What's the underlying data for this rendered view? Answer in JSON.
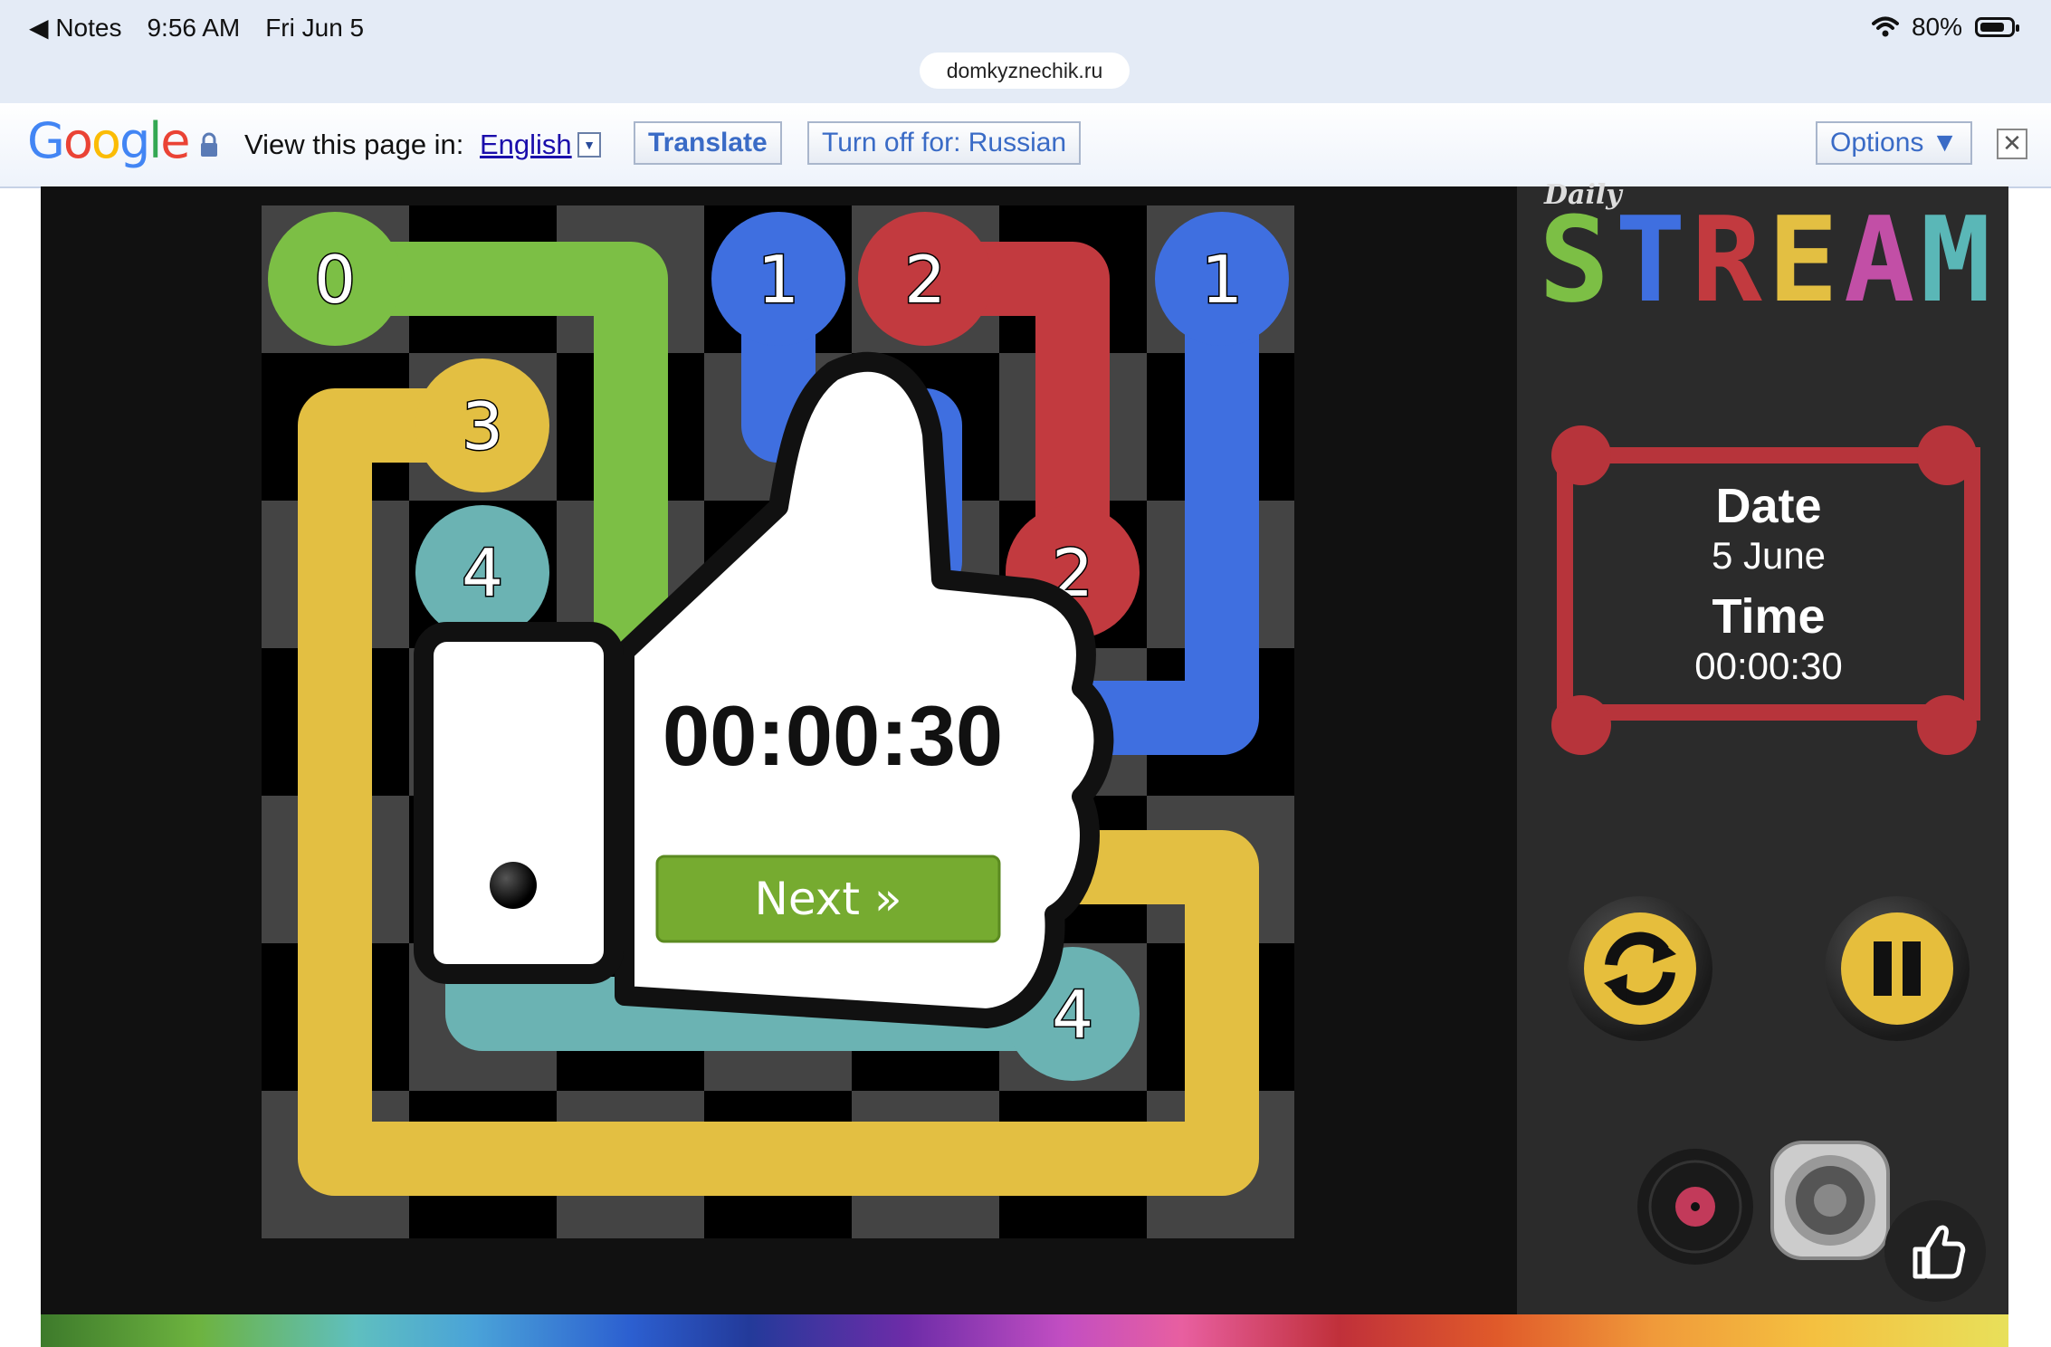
{
  "status_bar": {
    "back_label": "◀ Notes",
    "time": "9:56 AM",
    "date": "Fri Jun 5",
    "battery": "80%",
    "url": "domkyznechik.ru"
  },
  "translate_bar": {
    "prompt": "View this page in:",
    "language": "English",
    "translate_label": "Translate",
    "turn_off_label": "Turn off for: Russian",
    "options_label": "Options ▼",
    "close_symbol": "✕",
    "google_letters": [
      "G",
      "o",
      "o",
      "g",
      "l",
      "e"
    ]
  },
  "game": {
    "title_small": "Daily",
    "title_letters": [
      "S",
      "T",
      "R",
      "E",
      "A",
      "M"
    ],
    "title_colors": [
      "#7cbf45",
      "#3f6fe0",
      "#c23a3f",
      "#e3bf42",
      "#c24fa6",
      "#5ab7b7"
    ],
    "date_label": "Date",
    "date_value": "5 June",
    "time_label": "Time",
    "time_value": "00:00:30",
    "popup_time": "00:00:30",
    "next_label": "Next »",
    "colors": {
      "green": "#7cbf45",
      "blue": "#3f6fe0",
      "red": "#c23a3f",
      "yellow": "#e3bf42",
      "teal": "#6bb3b3"
    },
    "endpoints": [
      {
        "n": "0",
        "color": "green"
      },
      {
        "n": "1",
        "color": "blue"
      },
      {
        "n": "2",
        "color": "red"
      },
      {
        "n": "1",
        "color": "blue"
      },
      {
        "n": "3",
        "color": "yellow"
      },
      {
        "n": "4",
        "color": "teal"
      },
      {
        "n": "2",
        "color": "red"
      },
      {
        "n": "4",
        "color": "teal"
      }
    ]
  }
}
